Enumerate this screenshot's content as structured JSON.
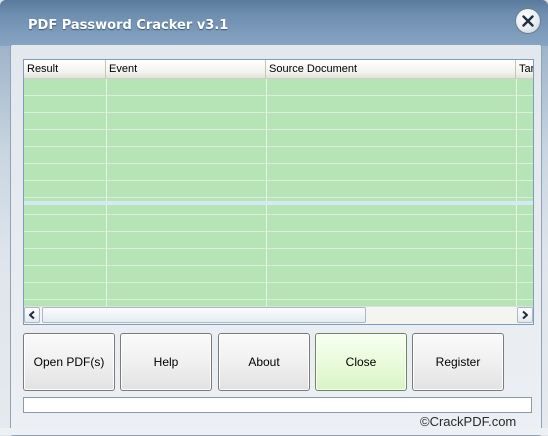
{
  "window": {
    "title": "PDF Password Cracker v3.1"
  },
  "list": {
    "columns": [
      {
        "label": "Result"
      },
      {
        "label": "Event"
      },
      {
        "label": "Source Document"
      },
      {
        "label": "Tar"
      }
    ]
  },
  "buttons": {
    "open_label": "Open PDF(s)",
    "help_label": "Help",
    "about_label": "About",
    "close_label": "Close",
    "register_label": "Register"
  },
  "watermark": "©CrackPDF.com",
  "icons": {
    "close": "close-icon",
    "scroll_left": "arrow-left-icon",
    "scroll_right": "arrow-right-icon"
  },
  "colors": {
    "row_green": "#b6e4b6",
    "title_blue": "#6e8eb0",
    "active_button": "#eafbdc"
  }
}
